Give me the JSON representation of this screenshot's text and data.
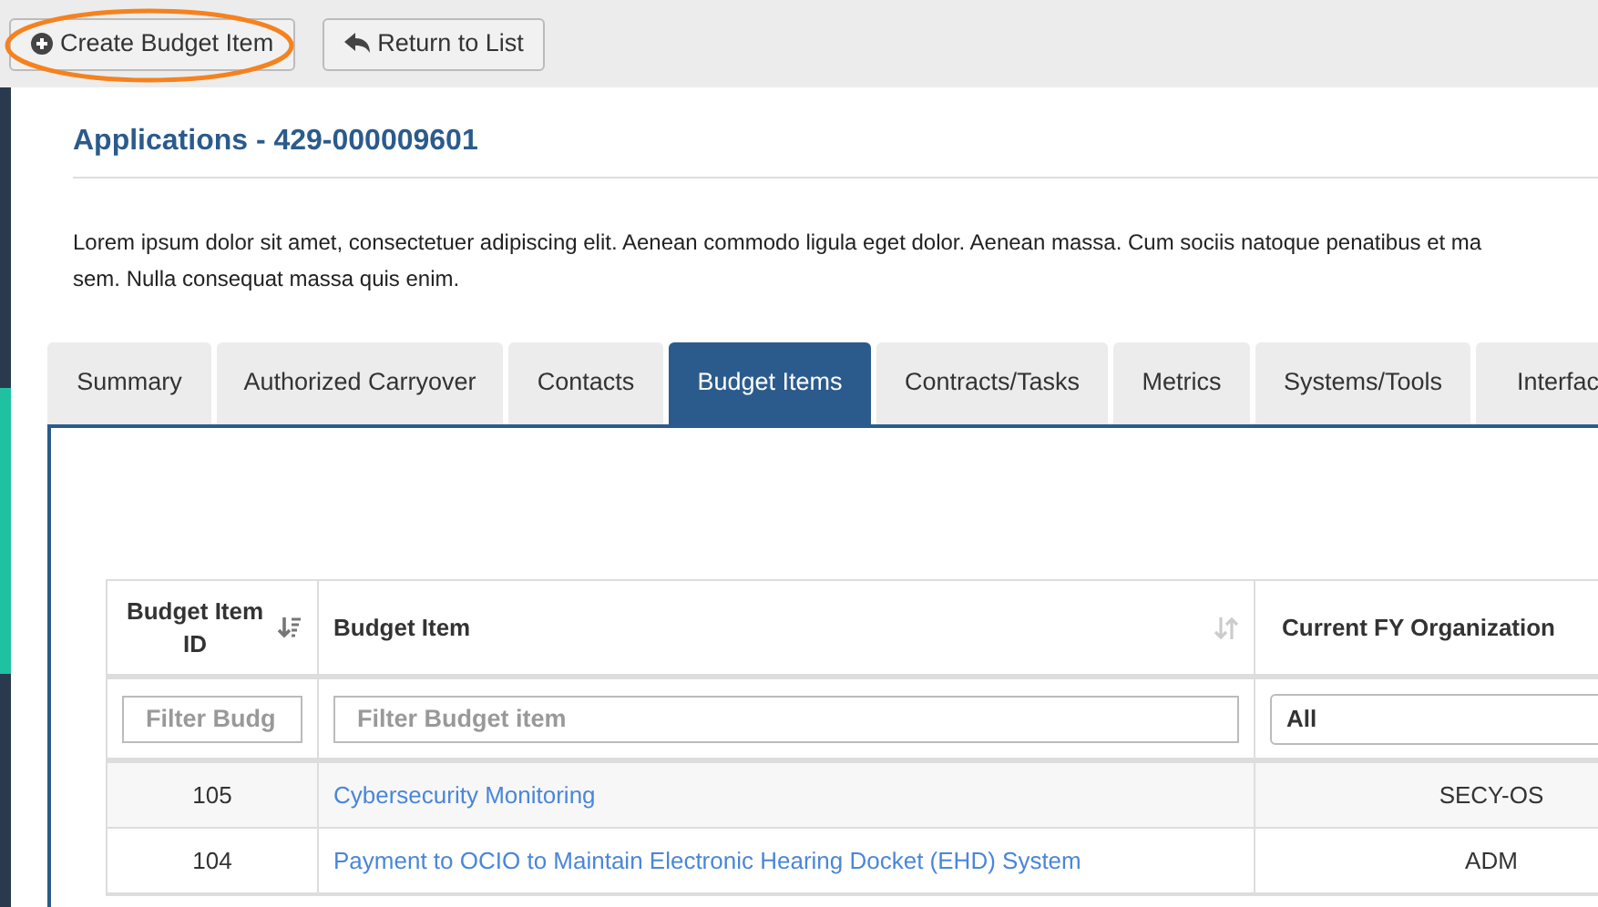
{
  "toolbar": {
    "buttons": [
      {
        "kind": "create",
        "label": "Create Budget Item",
        "highlighted": true
      },
      {
        "kind": "return",
        "label": "Return to List",
        "highlighted": false
      }
    ]
  },
  "title": "Applications - 429-000009601",
  "description": [
    "Lorem ipsum dolor sit amet, consectetuer adipiscing elit. Aenean commodo ligula eget dolor. Aenean massa. Cum sociis natoque penatibus et ma",
    "sem. Nulla consequat massa quis enim."
  ],
  "tabs": [
    {
      "label": "Summary",
      "selected": false
    },
    {
      "label": "Authorized Carryover",
      "selected": false
    },
    {
      "label": "Contacts",
      "selected": false
    },
    {
      "label": "Budget Items",
      "selected": true
    },
    {
      "label": "Contracts/Tasks",
      "selected": false
    },
    {
      "label": "Metrics",
      "selected": false
    },
    {
      "label": "Systems/Tools",
      "selected": false
    },
    {
      "label": "Interfac",
      "selected": false
    }
  ],
  "table": {
    "columns": [
      {
        "label": "Budget Item ID",
        "sortable": true,
        "sorted": true,
        "filter": {
          "kind": "text",
          "placeholder": "Filter Budg"
        }
      },
      {
        "label": "Budget Item",
        "sortable": true,
        "sorted": false,
        "filter": {
          "kind": "text",
          "placeholder": "Filter Budget item"
        }
      },
      {
        "label": "Current FY Organization",
        "sortable": false,
        "filter": {
          "kind": "select",
          "value": "All"
        }
      }
    ],
    "rows": [
      {
        "id": "105",
        "item": "Cybersecurity Monitoring",
        "org": "SECY-OS"
      },
      {
        "id": "104",
        "item": "Payment to OCIO to Maintain Electronic Hearing Docket (EHD) System",
        "org": "ADM"
      }
    ]
  }
}
